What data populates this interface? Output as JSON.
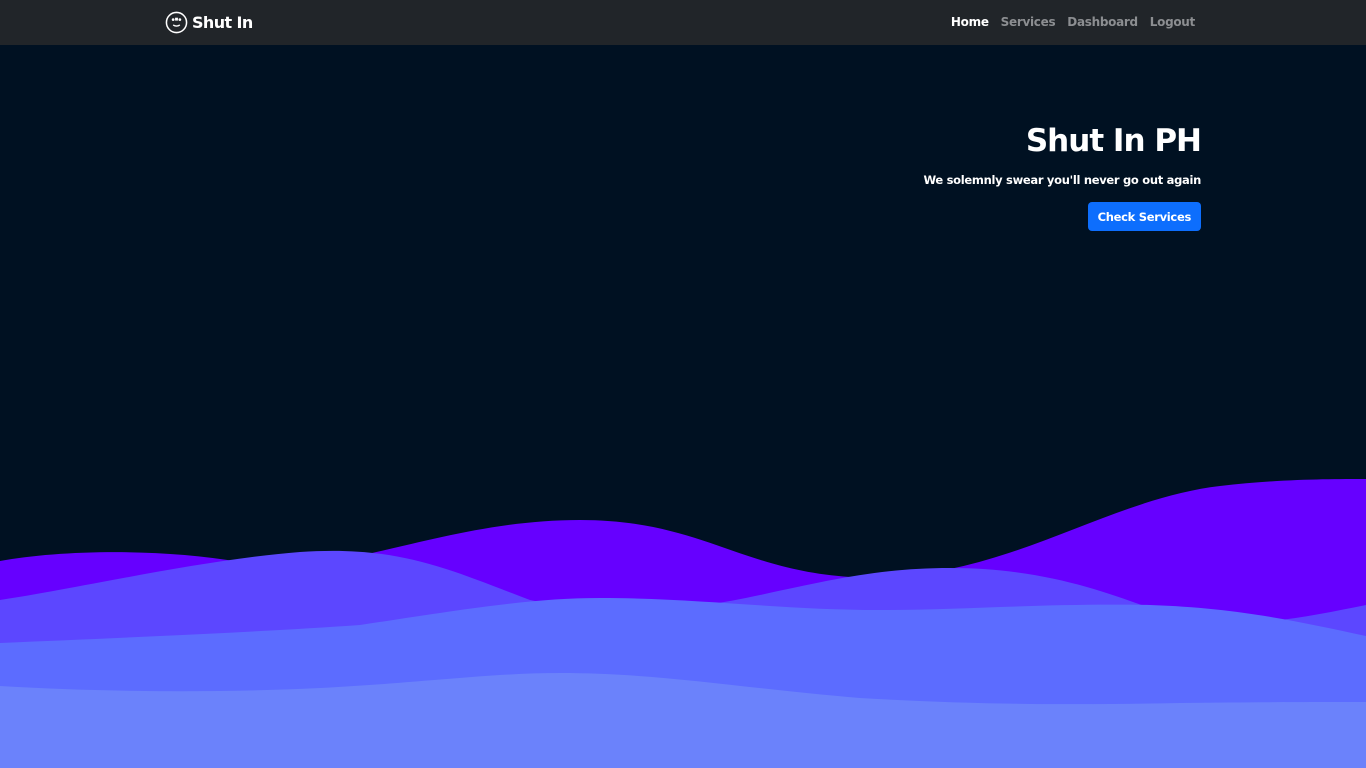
{
  "navbar": {
    "brand_icon": "smiley-face-icon",
    "brand_label": "Shut In",
    "links": [
      {
        "label": "Home",
        "active": true
      },
      {
        "label": "Services",
        "active": false
      },
      {
        "label": "Dashboard",
        "active": false
      },
      {
        "label": "Logout",
        "active": false
      }
    ]
  },
  "hero": {
    "title": "Shut In PH",
    "subtitle": "We solemnly swear you'll never go out again",
    "button_label": "Check Services"
  },
  "colors": {
    "page_background": "#001122",
    "navbar_background": "#212529",
    "primary_button": "#0d6efd",
    "wave_1": "#6600ff",
    "wave_2": "#5c47ff",
    "wave_3": "#5c6cff",
    "wave_4": "#6b82fb"
  }
}
